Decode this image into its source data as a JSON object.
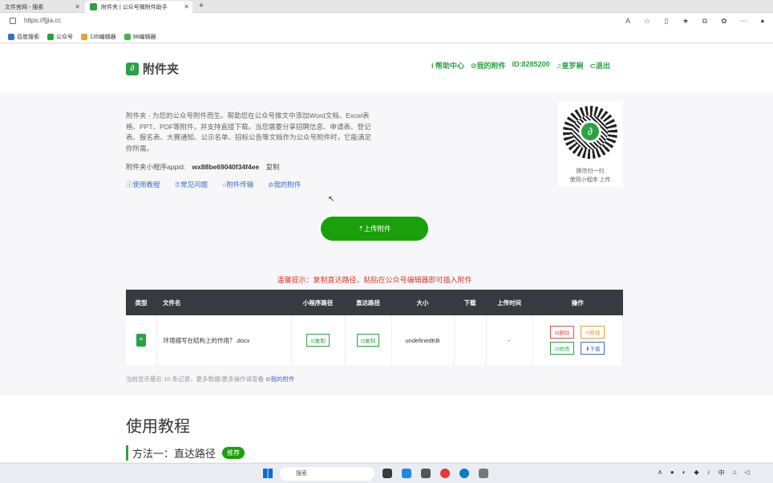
{
  "browser": {
    "tabs": [
      {
        "label": "文件官网 - 搜索"
      },
      {
        "label": "附件夹 | 公众号微附件助手"
      }
    ],
    "url": "https://fjjia.cc",
    "bookmarks": [
      {
        "label": "百度搜索",
        "color": "#3b6fc4"
      },
      {
        "label": "公众号",
        "color": "#2ba245"
      },
      {
        "label": "135编辑器",
        "color": "#e6a23c"
      },
      {
        "label": "96编辑器",
        "color": "#4caf50"
      }
    ]
  },
  "header": {
    "logo_text": "附件夹",
    "nav": [
      {
        "label": "i 帮助中心"
      },
      {
        "label": "⊘我的附件"
      },
      {
        "label": "ID:8285200"
      },
      {
        "label": "♫皇罗裥"
      },
      {
        "label": "⊂退出"
      }
    ]
  },
  "intro": {
    "description": "附件夹 - 为您的公众号附件而生。帮助您在公众号推文中添加Word文档、Excel表格、PPT、PDF等附件，并支持直接下载。当您需要分享招聘信息、申请表、登记表、报名表、大赛通知、公示名单、招标公告等文档作为公众号附件时，它能满足你所需。",
    "appid_label": "附件夹小程序appid:",
    "appid_value": "wx88be69040f34f4ee",
    "copy_label": "复制",
    "links": [
      {
        "label": "ⓘ使用教程"
      },
      {
        "label": "⑦常见问题"
      },
      {
        "label": "○附件传输"
      },
      {
        "label": "⊘我的附件"
      }
    ]
  },
  "qr": {
    "caption1": "微信扫一扫",
    "caption2": "使用小程序 上传"
  },
  "upload_button": "⇡上传附件",
  "tip": "温馨提示：复制直达路径，粘贴在公众号编辑器即可插入附件",
  "table": {
    "headers": [
      "类型",
      "文件名",
      "小程序路径",
      "直达路径",
      "大小",
      "下载",
      "上传时间",
      "操作"
    ],
    "rows": [
      {
        "filename": "环境描写在结构上的作用？.docx",
        "mini_copy": "⊡复制",
        "direct_copy": "⊡复制",
        "size": "undefinedKB",
        "download": "",
        "upload_time": "-",
        "ops": {
          "delete": "⊟删除",
          "replace": "⟲替换",
          "edit": "⊡修改",
          "download": "⬇下载"
        }
      }
    ]
  },
  "table_note": "当前显示最近 10 条记录，更多数据/更多操作请查看",
  "table_note_link": "⊘我的附件",
  "tutorial": {
    "title": "使用教程",
    "method": "方法一：直达路径",
    "badge": "推荐"
  },
  "taskbar": {
    "search_placeholder": "搜索",
    "ime": "中"
  }
}
